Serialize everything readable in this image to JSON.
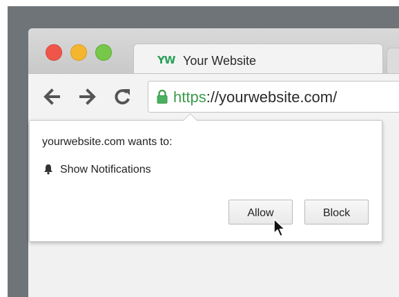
{
  "tab": {
    "favicon_text": "YW",
    "title": "Your Website"
  },
  "address_bar": {
    "scheme": "https",
    "rest": "://yourwebsite.com/"
  },
  "permission_popup": {
    "title": "yourwebsite.com wants to:",
    "permission": "Show Notifications",
    "allow_label": "Allow",
    "block_label": "Block"
  },
  "colors": {
    "secure_green": "#3a9c4b",
    "favicon_green": "#2aa05a",
    "close": "#f0554a",
    "minimize": "#f5b62f",
    "zoom": "#77c84a"
  }
}
